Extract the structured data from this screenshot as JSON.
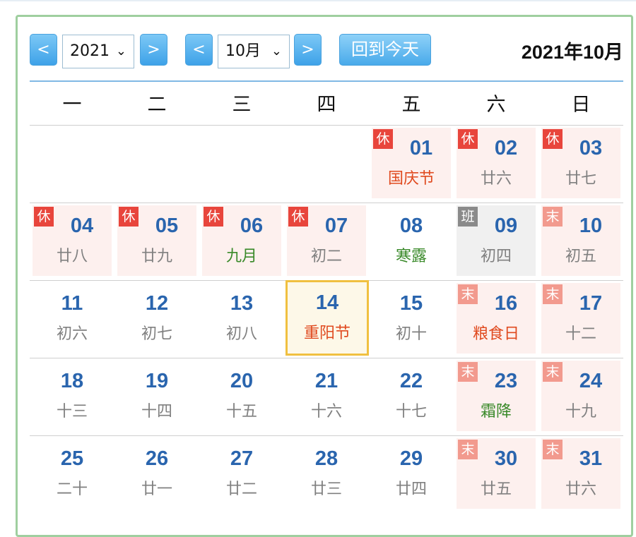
{
  "toolbar": {
    "prev_label": "<",
    "next_label": ">",
    "year_value": "2021",
    "month_value": "10月",
    "today_label": "回到今天",
    "current_title": "2021年10月"
  },
  "weekdays": [
    "一",
    "二",
    "三",
    "四",
    "五",
    "六",
    "日"
  ],
  "colors": {
    "accent": "#3ea2e8",
    "day_number": "#2a65ae",
    "festival": "#e04a1f",
    "solar_term": "#3a8a2a",
    "rest_badge": "#e8453c",
    "weekend_badge": "#f29a8e",
    "work_badge": "#8a8a8a",
    "today_border": "#f0c040"
  },
  "badge_text": {
    "rest": "休",
    "weekend": "末",
    "work": "班"
  },
  "weeks": [
    [
      null,
      null,
      null,
      null,
      {
        "day": "01",
        "lunar": "国庆节",
        "bg": "holiday",
        "badge": "rest",
        "lunarClass": "festival"
      },
      {
        "day": "02",
        "lunar": "廿六",
        "bg": "holiday",
        "badge": "rest"
      },
      {
        "day": "03",
        "lunar": "廿七",
        "bg": "holiday",
        "badge": "rest"
      }
    ],
    [
      {
        "day": "04",
        "lunar": "廿八",
        "bg": "holiday",
        "badge": "rest"
      },
      {
        "day": "05",
        "lunar": "廿九",
        "bg": "holiday",
        "badge": "rest"
      },
      {
        "day": "06",
        "lunar": "九月",
        "bg": "holiday",
        "badge": "rest",
        "lunarClass": "green"
      },
      {
        "day": "07",
        "lunar": "初二",
        "bg": "holiday",
        "badge": "rest"
      },
      {
        "day": "08",
        "lunar": "寒露",
        "lunarClass": "green"
      },
      {
        "day": "09",
        "lunar": "初四",
        "bg": "workday",
        "badge": "work"
      },
      {
        "day": "10",
        "lunar": "初五",
        "bg": "holiday",
        "badge": "weekend"
      }
    ],
    [
      {
        "day": "11",
        "lunar": "初六"
      },
      {
        "day": "12",
        "lunar": "初七"
      },
      {
        "day": "13",
        "lunar": "初八"
      },
      {
        "day": "14",
        "lunar": "重阳节",
        "bg": "today",
        "lunarClass": "festival"
      },
      {
        "day": "15",
        "lunar": "初十"
      },
      {
        "day": "16",
        "lunar": "粮食日",
        "bg": "holiday",
        "badge": "weekend",
        "lunarClass": "festival"
      },
      {
        "day": "17",
        "lunar": "十二",
        "bg": "holiday",
        "badge": "weekend"
      }
    ],
    [
      {
        "day": "18",
        "lunar": "十三"
      },
      {
        "day": "19",
        "lunar": "十四"
      },
      {
        "day": "20",
        "lunar": "十五"
      },
      {
        "day": "21",
        "lunar": "十六"
      },
      {
        "day": "22",
        "lunar": "十七"
      },
      {
        "day": "23",
        "lunar": "霜降",
        "bg": "holiday",
        "badge": "weekend",
        "lunarClass": "green"
      },
      {
        "day": "24",
        "lunar": "十九",
        "bg": "holiday",
        "badge": "weekend"
      }
    ],
    [
      {
        "day": "25",
        "lunar": "二十"
      },
      {
        "day": "26",
        "lunar": "廿一"
      },
      {
        "day": "27",
        "lunar": "廿二"
      },
      {
        "day": "28",
        "lunar": "廿三"
      },
      {
        "day": "29",
        "lunar": "廿四"
      },
      {
        "day": "30",
        "lunar": "廿五",
        "bg": "holiday",
        "badge": "weekend"
      },
      {
        "day": "31",
        "lunar": "廿六",
        "bg": "holiday",
        "badge": "weekend"
      }
    ]
  ]
}
